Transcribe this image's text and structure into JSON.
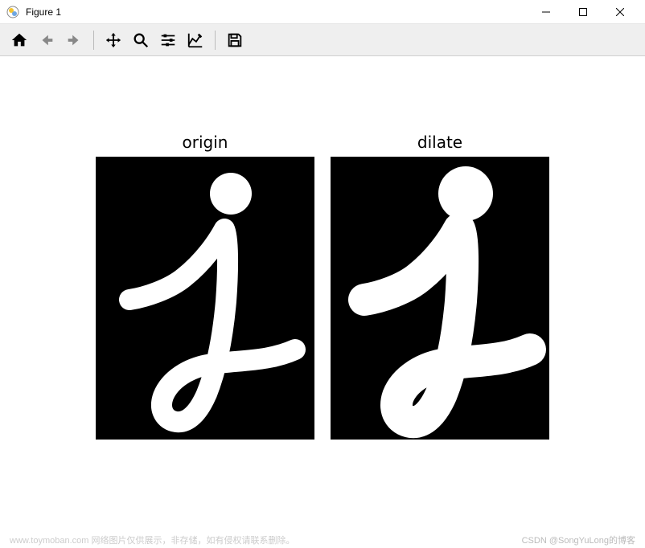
{
  "window": {
    "title": "Figure 1"
  },
  "toolbar": {
    "home": "Home",
    "back": "Back",
    "forward": "Forward",
    "pan": "Pan",
    "zoom": "Zoom",
    "subplots": "Configure subplots",
    "axes": "Edit axis",
    "save": "Save"
  },
  "plots": [
    {
      "title": "origin"
    },
    {
      "title": "dilate"
    }
  ],
  "footer": {
    "left": "www.toymoban.com 网络图片仅供展示，非存储，如有侵权请联系删除。",
    "right": "CSDN @SongYuLong的博客"
  }
}
